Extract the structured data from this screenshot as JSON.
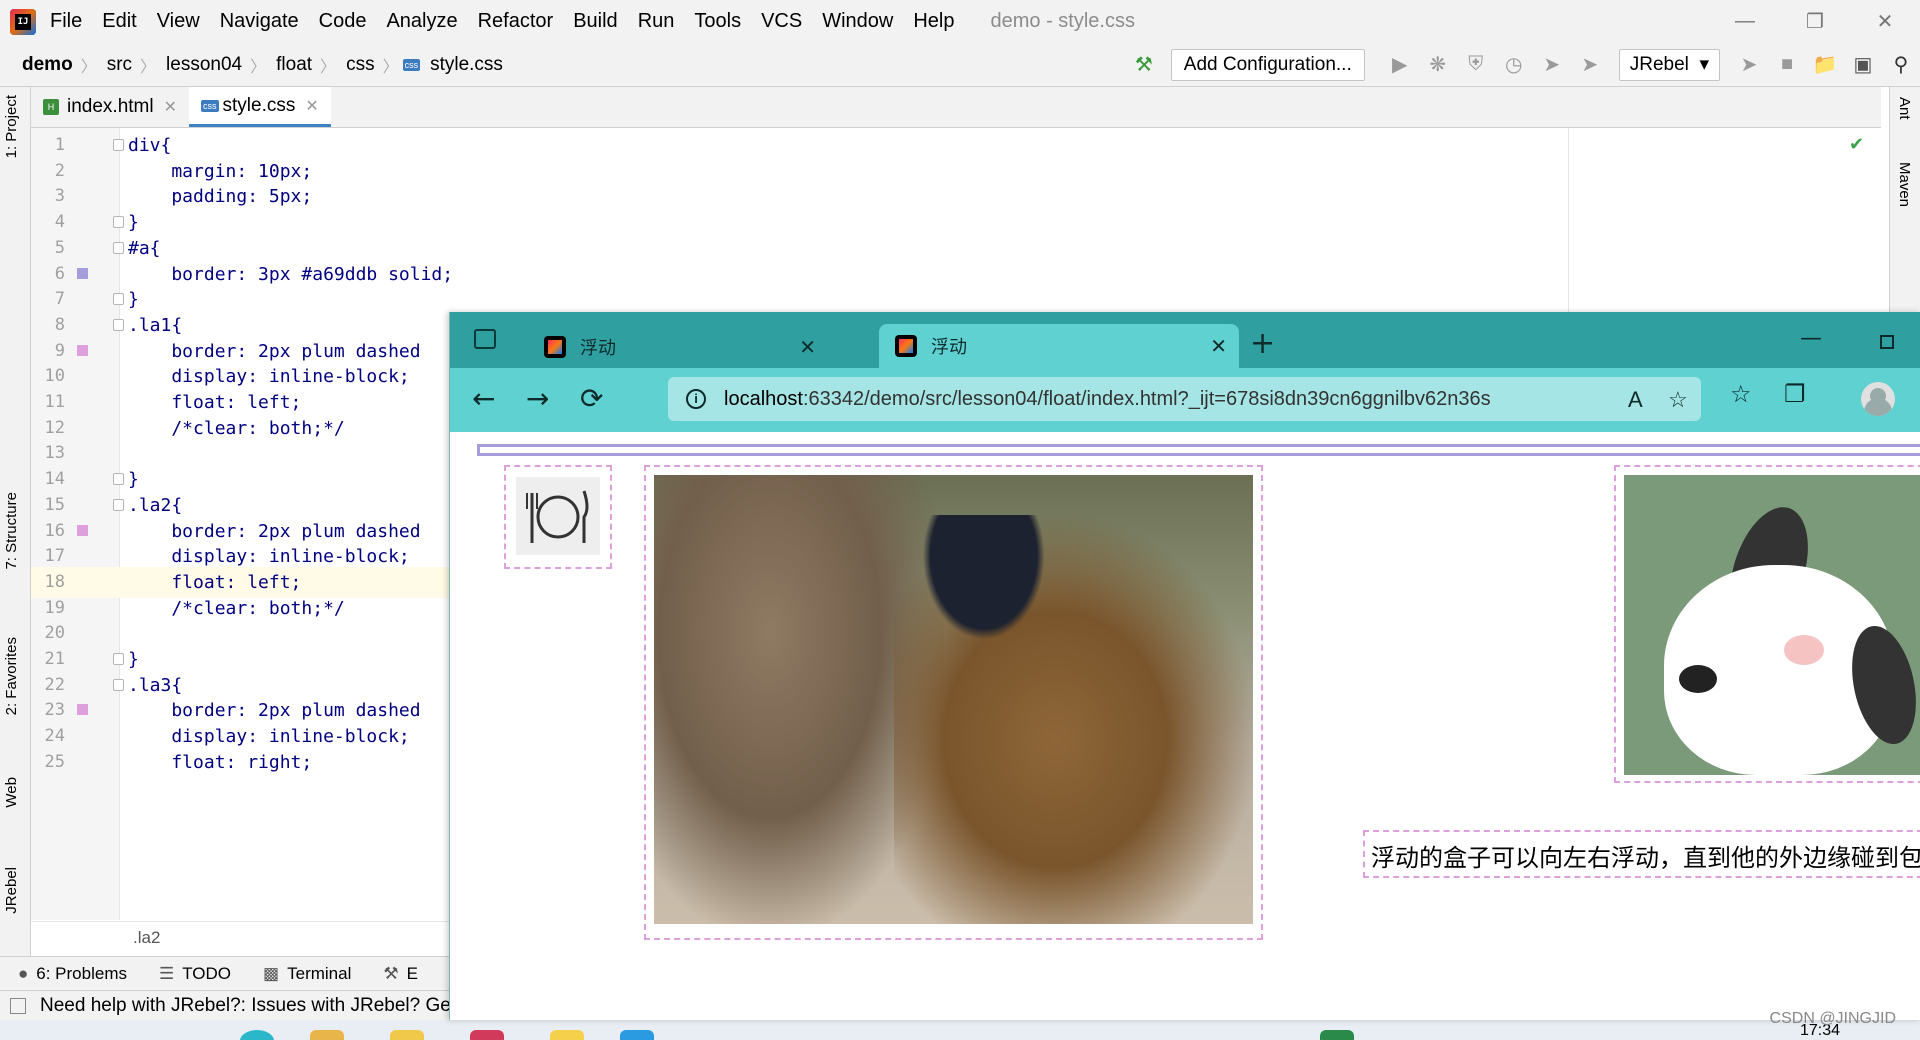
{
  "app": {
    "window_title": "demo - style.css",
    "menu": [
      "File",
      "Edit",
      "View",
      "Navigate",
      "Code",
      "Analyze",
      "Refactor",
      "Build",
      "Run",
      "Tools",
      "VCS",
      "Window",
      "Help"
    ]
  },
  "navbar": {
    "breadcrumbs": [
      "demo",
      "src",
      "lesson04",
      "float",
      "css",
      "style.css"
    ],
    "add_config_label": "Add Configuration...",
    "jrebel_label": "JRebel"
  },
  "editor_tabs": [
    {
      "label": "index.html",
      "badge": "H",
      "active": false
    },
    {
      "label": "style.css",
      "badge": "css",
      "active": true
    }
  ],
  "left_tools": [
    "1: Project",
    "7: Structure",
    "2: Favorites",
    "Web",
    "JRebel"
  ],
  "right_tools": [
    "Ant",
    "Maven"
  ],
  "code_lines": [
    {
      "n": "1",
      "text": "div{"
    },
    {
      "n": "2",
      "text": "    margin: 10px;"
    },
    {
      "n": "3",
      "text": "    padding: 5px;"
    },
    {
      "n": "4",
      "text": "}"
    },
    {
      "n": "5",
      "text": "#a{"
    },
    {
      "n": "6",
      "text": "    border: 3px #a69ddb solid;"
    },
    {
      "n": "7",
      "text": "}"
    },
    {
      "n": "8",
      "text": ".la1{"
    },
    {
      "n": "9",
      "text": "    border: 2px plum dashed"
    },
    {
      "n": "10",
      "text": "    display: inline-block;"
    },
    {
      "n": "11",
      "text": "    float: left;"
    },
    {
      "n": "12",
      "text": "    /*clear: both;*/"
    },
    {
      "n": "13",
      "text": ""
    },
    {
      "n": "14",
      "text": "}"
    },
    {
      "n": "15",
      "text": ".la2{"
    },
    {
      "n": "16",
      "text": "    border: 2px plum dashed"
    },
    {
      "n": "17",
      "text": "    display: inline-block;"
    },
    {
      "n": "18",
      "text": "    float: left;"
    },
    {
      "n": "19",
      "text": "    /*clear: both;*/"
    },
    {
      "n": "20",
      "text": ""
    },
    {
      "n": "21",
      "text": "}"
    },
    {
      "n": "22",
      "text": ".la3{"
    },
    {
      "n": "23",
      "text": "    border: 2px plum dashed"
    },
    {
      "n": "24",
      "text": "    display: inline-block;"
    },
    {
      "n": "25",
      "text": "    float: right;"
    }
  ],
  "current_line": "18",
  "editor_footer_breadcrumb": ".la2",
  "bottom_tools": [
    "6: Problems",
    "TODO",
    "Terminal",
    "E"
  ],
  "status_message": "Need help with JRebel?: Issues with JRebel? Get",
  "browser": {
    "tabs": [
      {
        "label": "浮动",
        "active": false
      },
      {
        "label": "浮动",
        "active": true
      }
    ],
    "address_host": "localhost",
    "address_rest": ":63342/demo/src/lesson04/float/index.html?_ijt=678si8dn39cn6ggnilbv62n36s",
    "page_text": "浮动的盒子可以向左右浮动，直到他的外边缘碰到包"
  },
  "taskbar": {
    "time": "17:34"
  },
  "watermark": "CSDN @JINGJID",
  "colors": {
    "div_a_border": "#a69ddb",
    "dashed_border": "plum",
    "browser_tabstrip": "#2f9fa0",
    "browser_toolbar": "#5fd1d1"
  }
}
